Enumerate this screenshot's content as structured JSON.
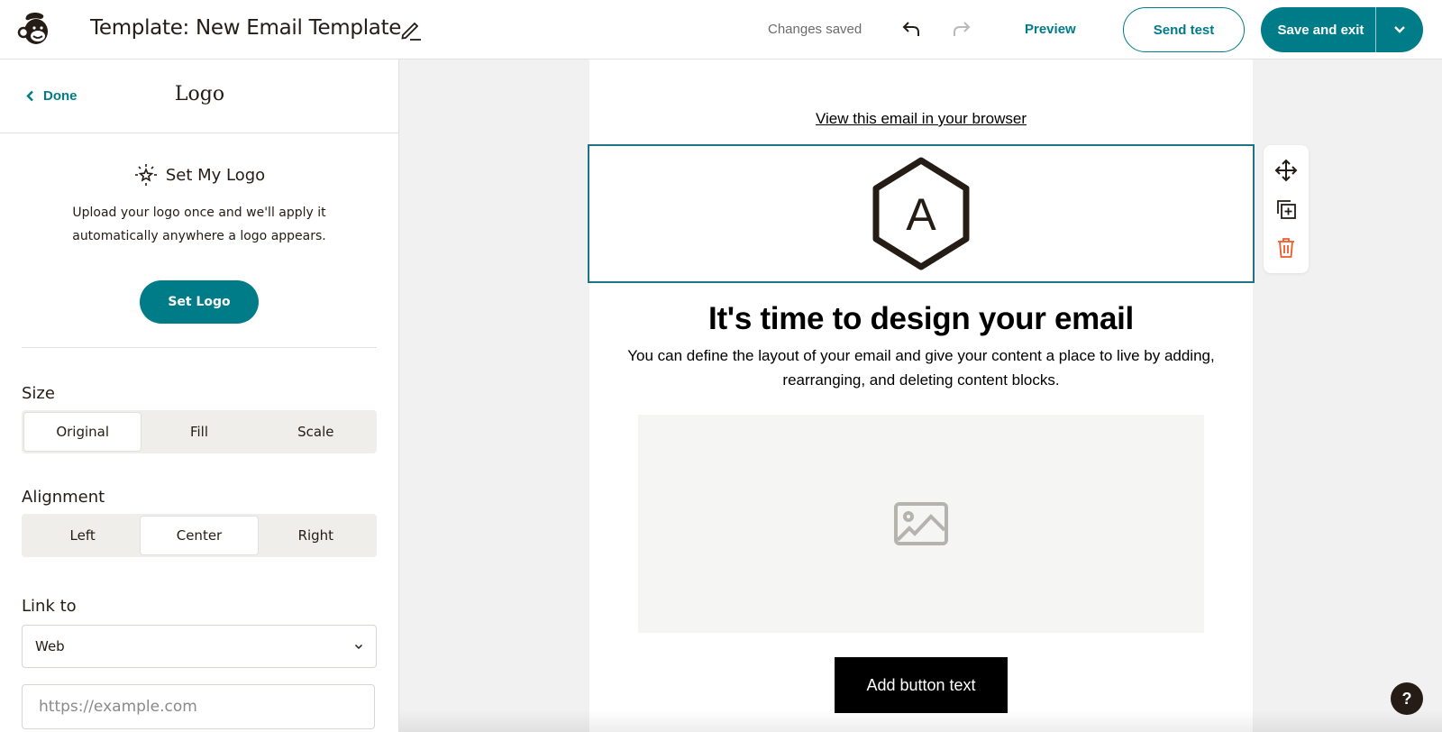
{
  "header": {
    "logo_icon": "mailchimp-freddie-icon",
    "title": "Template: New Email Template",
    "edit_icon": "pencil-icon",
    "status": "Changes saved",
    "undo_icon": "undo-icon",
    "redo_icon": "redo-icon",
    "preview_label": "Preview",
    "send_test_label": "Send test",
    "save_exit_label": "Save and exit",
    "save_menu_icon": "chevron-down-icon"
  },
  "sidebar": {
    "done_label": "Done",
    "title": "Logo",
    "set_logo": {
      "icon": "sparkle-star-icon",
      "heading": "Set My Logo",
      "description": "Upload your logo once and we'll apply it automatically anywhere a logo appears.",
      "button_label": "Set Logo"
    },
    "size": {
      "label": "Size",
      "options": [
        "Original",
        "Fill",
        "Scale"
      ],
      "selected": "Original"
    },
    "alignment": {
      "label": "Alignment",
      "options": [
        "Left",
        "Center",
        "Right"
      ],
      "selected": "Center"
    },
    "link_to": {
      "label": "Link to",
      "selected": "Web",
      "url_value": "",
      "url_placeholder": "https://example.com"
    }
  },
  "email": {
    "view_in_browser": "View this email in your browser",
    "logo_letter": "A",
    "headline": "It's time to design your email",
    "body": "You can define the layout of your email and give your content a place to live by adding, rearranging, and deleting content blocks.",
    "image_placeholder_icon": "image-icon",
    "button_label": "Add button text"
  },
  "block_tools": {
    "move_icon": "move-arrows-icon",
    "duplicate_icon": "duplicate-icon",
    "delete_icon": "trash-icon"
  },
  "help_label": "?",
  "colors": {
    "brand": "#007c89",
    "selection_border": "#1c7484",
    "delete": "#f05a28",
    "text": "#241c15"
  }
}
